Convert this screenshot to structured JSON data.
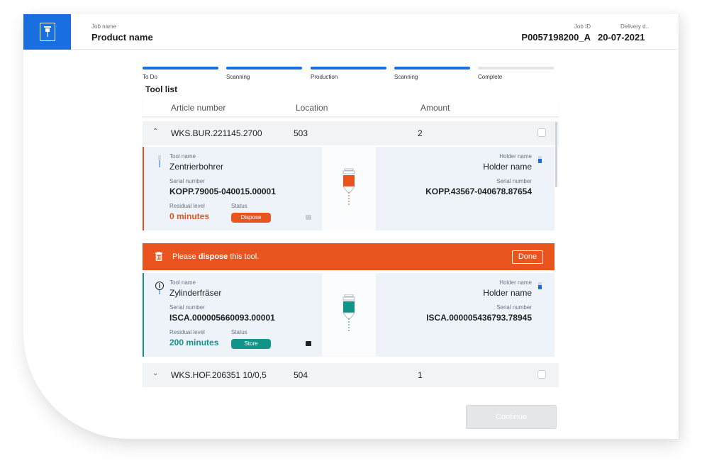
{
  "header": {
    "job_name_label": "Job name",
    "job_name_value": "Product name",
    "job_id_label": "Job ID",
    "job_id_value": "P0057198200_A",
    "delivery_label": "Delivery d...",
    "delivery_value": "20-07-2021",
    "logo_icon": "drill-icon"
  },
  "steps": [
    {
      "label": "To Do",
      "state": "done"
    },
    {
      "label": "Scanning",
      "state": "done"
    },
    {
      "label": "Production",
      "state": "done"
    },
    {
      "label": "Scanning",
      "state": "done"
    },
    {
      "label": "Complete",
      "state": "pending"
    }
  ],
  "tool_list": {
    "title": "Tool list",
    "columns": [
      "Article number",
      "Location",
      "Amount"
    ],
    "groups": [
      {
        "article": "WKS.BUR.221145.2700",
        "location": "503",
        "amount": "2",
        "expanded": true
      },
      {
        "article": "WKS.HOF.206351 10/0,5",
        "location": "504",
        "amount": "1",
        "expanded": false
      }
    ],
    "tools": [
      {
        "tool_name_label": "Tool name",
        "tool_name": "Zentrierbohrer",
        "serial_label": "Serial number",
        "serial": "KOPP.79005-040015.00001",
        "residual_label": "Residual level",
        "residual": "0 minutes",
        "status_label": "Status",
        "status": "Dispose",
        "holder_name_label": "Holder name",
        "holder_name": "Holder name",
        "holder_serial_label": "Serial number",
        "holder_serial": "KOPP.43567-040678.87654",
        "color": "#e9541e"
      },
      {
        "tool_name_label": "Tool name",
        "tool_name": "Zylinderfräser",
        "serial_label": "Serial number",
        "serial": "ISCA.000005660093.00001",
        "residual_label": "Residual level",
        "residual": "200 minutes",
        "status_label": "Status",
        "status": "Store",
        "holder_name_label": "Holder name",
        "holder_name": "Holder name",
        "holder_serial_label": "Serial number",
        "holder_serial": "ISCA.000005436793.78945",
        "color": "#13948a"
      }
    ],
    "alert": {
      "prefix": "Please ",
      "emphasis": "dispose",
      "suffix": " this tool.",
      "done_label": "Done"
    }
  },
  "footer": {
    "continue_label": "Continue"
  },
  "colors": {
    "brand": "#1a6fe0",
    "dispose": "#e9541e",
    "store": "#13948a"
  }
}
